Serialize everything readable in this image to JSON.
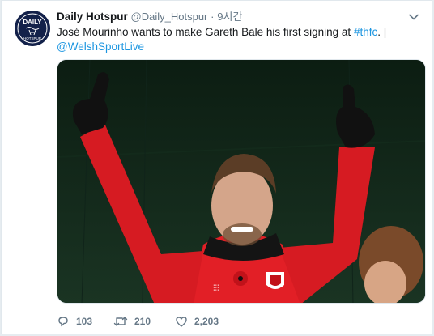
{
  "tweet": {
    "display_name": "Daily Hotspur",
    "handle": "@Daily_Hotspur",
    "separator": "·",
    "time": "9시간",
    "text_main": "José Mourinho wants to make Gareth Bale his first signing at ",
    "hashtag": "#thfc",
    "text_after_hashtag": ". |",
    "mention": "@WelshSportLive",
    "avatar": {
      "logo_line1": "DAILY",
      "logo_line2": "HOTSPUR",
      "background": "#13214a"
    },
    "media": {
      "icon": "photo-of-player-thumbs-up"
    },
    "actions": {
      "replies": "103",
      "retweets": "210",
      "likes": "2,203"
    }
  },
  "colors": {
    "link": "#1b95e0",
    "text": "#14171a",
    "muted": "#657786",
    "page_bg": "#e6ecf0"
  }
}
